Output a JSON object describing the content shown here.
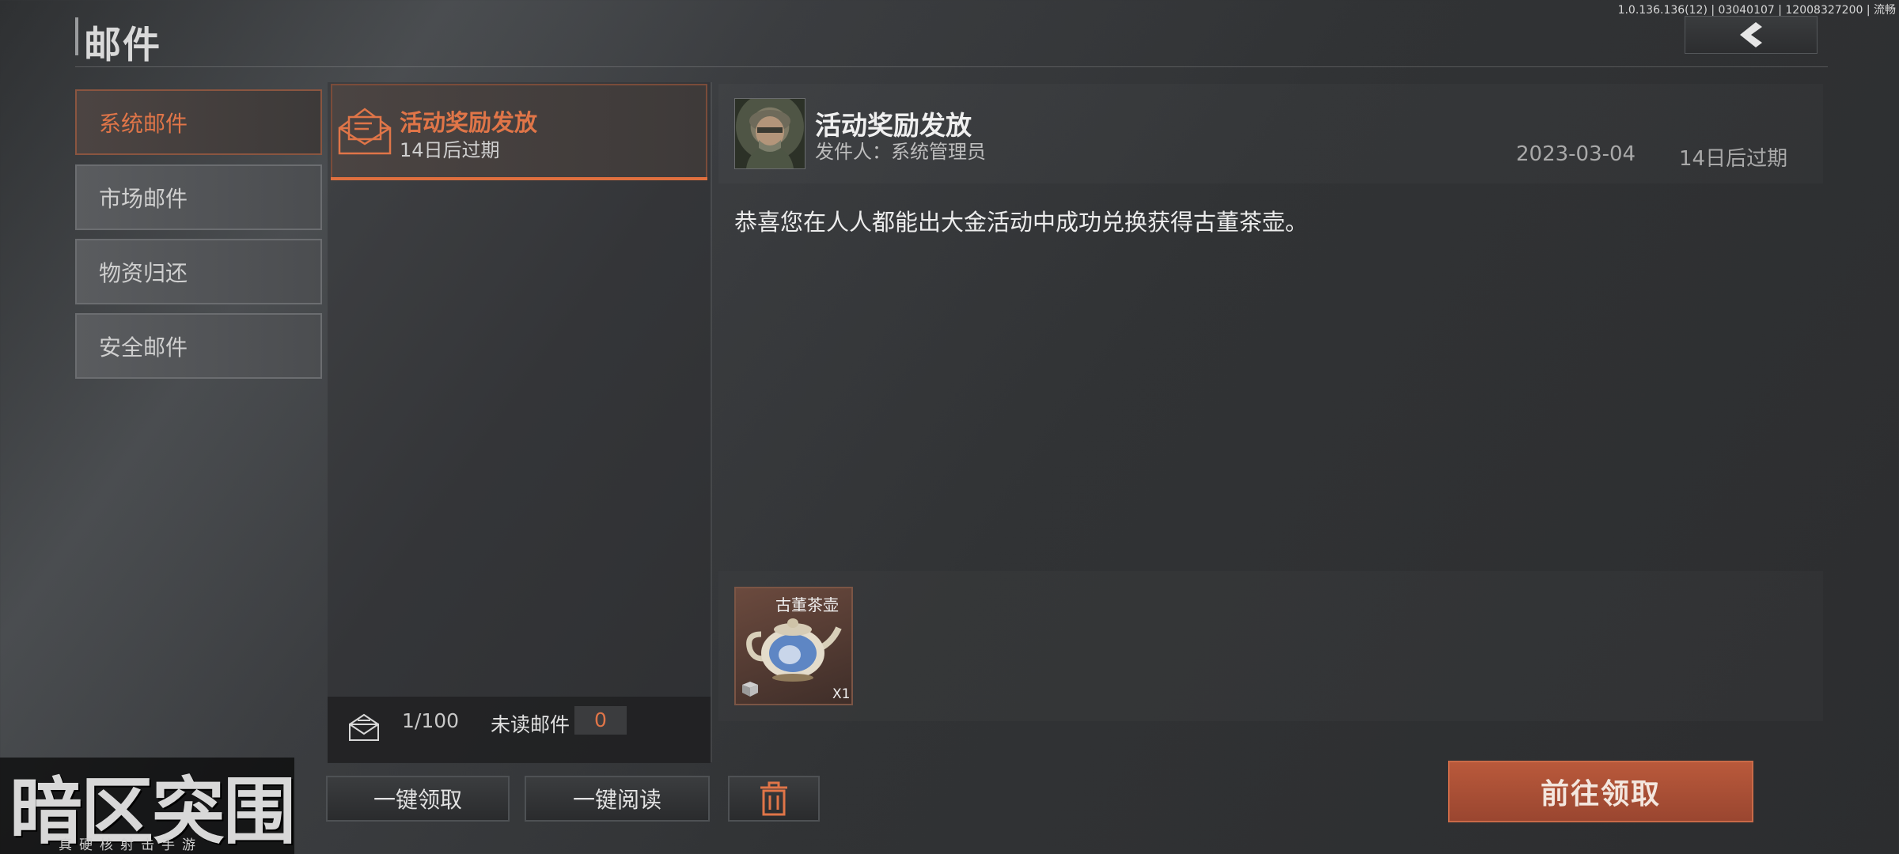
{
  "header": {
    "title": "邮件",
    "version": "1.0.136.136(12) | 03040107 | 12008327200 | 流畅"
  },
  "categories": [
    {
      "label": "系统邮件",
      "active": true
    },
    {
      "label": "市场邮件",
      "active": false
    },
    {
      "label": "物资归还",
      "active": false
    },
    {
      "label": "安全邮件",
      "active": false
    }
  ],
  "mail_list": {
    "items": [
      {
        "title": "活动奖励发放",
        "subtitle": "14日后过期",
        "selected": true
      }
    ],
    "count": "1/100",
    "unread_label": "未读邮件",
    "unread_count": "0"
  },
  "buttons": {
    "claim_all": "一键领取",
    "read_all": "一键阅读",
    "go_claim": "前往领取"
  },
  "detail": {
    "title": "活动奖励发放",
    "sender": "发件人：系统管理员",
    "date": "2023-03-04",
    "expire": "14日后过期",
    "body": "恭喜您在人人都能出大金活动中成功兑换获得古董茶壶。",
    "attachment": {
      "name": "古董茶壶",
      "quantity": "X1"
    }
  },
  "logo": {
    "title": "暗区突围",
    "subtitle": "真硬核射击手游"
  },
  "colors": {
    "accent": "#e07548",
    "button_primary": "#a94f35"
  }
}
